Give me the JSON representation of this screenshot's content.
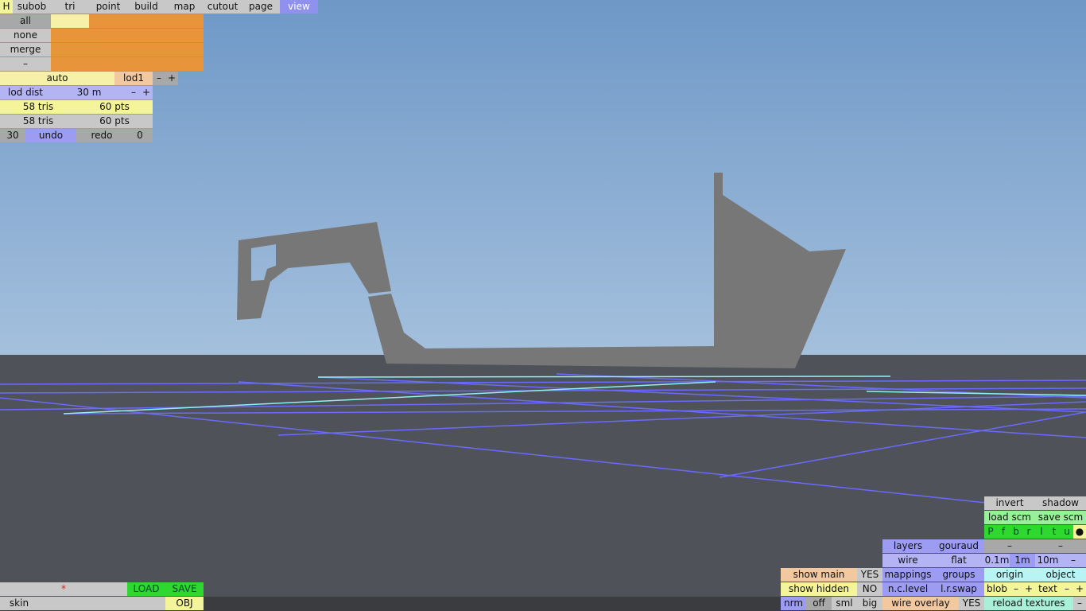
{
  "toolbar": {
    "h": "H",
    "tabs": [
      "subob",
      "tri",
      "point",
      "build",
      "map",
      "cutout",
      "page",
      "view"
    ],
    "active_tab": "view"
  },
  "selection": {
    "all": "all",
    "none": "none",
    "merge": "merge",
    "minus": "–"
  },
  "lod": {
    "auto": "auto",
    "name": "lod1",
    "minus": "–",
    "plus": "+",
    "dist_label": "lod dist",
    "dist_value": "30 m"
  },
  "stats": {
    "tris1": "58 tris",
    "pts1": "60 pts",
    "tris2": "58 tris",
    "pts2": "60 pts"
  },
  "history": {
    "undo_count": "30",
    "undo": "undo",
    "redo": "redo",
    "redo_count": "0"
  },
  "file": {
    "star": "*",
    "load": "LOAD",
    "save": "SAVE",
    "skin": "skin",
    "obj": "OBJ"
  },
  "right_panel": {
    "invert": "invert",
    "shadow": "shadow",
    "load_scm": "load scm",
    "save_scm": "save scm",
    "views": [
      "P",
      "f",
      "b",
      "r",
      "l",
      "t",
      "u",
      "●"
    ],
    "layers": "layers",
    "gouraud": "gouraud",
    "dash1": "–",
    "dash2": "–",
    "wire": "wire",
    "flat": "flat",
    "grid": [
      "0.1m",
      "1m",
      "10m"
    ],
    "grid_minus": "–",
    "show_main": "show main",
    "show_main_val": "YES",
    "mappings": "mappings",
    "groups": "groups",
    "origin": "origin",
    "object": "object",
    "show_hidden": "show hidden",
    "show_hidden_val": "NO",
    "nc_level": "n.c.level",
    "lr_swap": "l.r.swap",
    "blob": "blob",
    "blob_minus": "–",
    "blob_plus": "+",
    "text": "text",
    "text_minus": "–",
    "text_plus": "+",
    "sizes": [
      "nrm",
      "off",
      "sml",
      "big"
    ],
    "wire_overlay": "wire overlay",
    "wire_overlay_val": "YES",
    "reload_textures": "reload textures",
    "reload_minus": "–"
  },
  "colors": {
    "sky_top": "#6f98c7",
    "sky_bottom": "#a4c0dd",
    "ground": "#4f5259",
    "shape": "#777777",
    "grid_line": "#6a6aff",
    "grid_highlight": "#8ff0f0"
  }
}
